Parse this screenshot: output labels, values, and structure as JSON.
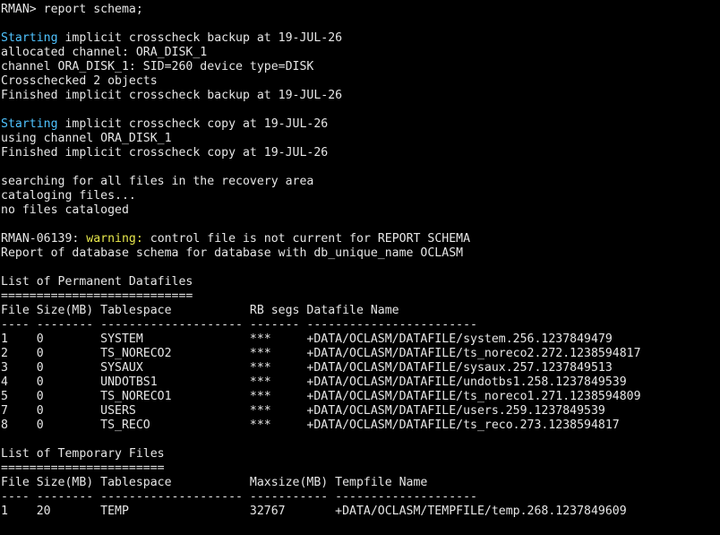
{
  "prompt": "RMAN>",
  "command": " report schema;",
  "crosscheck_backup": {
    "keyword": "Starting",
    "rest": " implicit crosscheck backup at 19-JUL-26",
    "line2": "allocated channel: ORA_DISK_1",
    "line3": "channel ORA_DISK_1: SID=260 device type=DISK",
    "line4": "Crosschecked 2 objects",
    "line5": "Finished implicit crosscheck backup at 19-JUL-26"
  },
  "crosscheck_copy": {
    "keyword": "Starting",
    "rest": " implicit crosscheck copy at 19-JUL-26",
    "line2": "using channel ORA_DISK_1",
    "line3": "Finished implicit crosscheck copy at 19-JUL-26"
  },
  "recovery_area": {
    "line1": "searching for all files in the recovery area",
    "line2": "cataloging files...",
    "line3": "no files cataloged"
  },
  "warning": {
    "code": "RMAN-06139:",
    "label": "warning:",
    "message": " control file is not current for REPORT SCHEMA"
  },
  "report_header": "Report of database schema for database with db_unique_name OCLASM",
  "permanent": {
    "title": "List of Permanent Datafiles",
    "underline": "===========================",
    "header": "File Size(MB) Tablespace           RB segs Datafile Name",
    "separator": "---- -------- -------------------- ------- ------------------------",
    "rows": [
      "1    0        SYSTEM               ***     +DATA/OCLASM/DATAFILE/system.256.1237849479",
      "2    0        TS_NORECO2           ***     +DATA/OCLASM/DATAFILE/ts_noreco2.272.1238594817",
      "3    0        SYSAUX               ***     +DATA/OCLASM/DATAFILE/sysaux.257.1237849513",
      "4    0        UNDOTBS1             ***     +DATA/OCLASM/DATAFILE/undotbs1.258.1237849539",
      "5    0        TS_NORECO1           ***     +DATA/OCLASM/DATAFILE/ts_noreco1.271.1238594809",
      "7    0        USERS                ***     +DATA/OCLASM/DATAFILE/users.259.1237849539",
      "8    0        TS_RECO              ***     +DATA/OCLASM/DATAFILE/ts_reco.273.1238594817"
    ]
  },
  "temporary": {
    "title": "List of Temporary Files",
    "underline": "=======================",
    "header": "File Size(MB) Tablespace           Maxsize(MB) Tempfile Name",
    "separator": "---- -------- -------------------- ----------- --------------------",
    "rows": [
      "1    20       TEMP                 32767       +DATA/OCLASM/TEMPFILE/temp.268.1237849609"
    ]
  },
  "final_prompt": ""
}
